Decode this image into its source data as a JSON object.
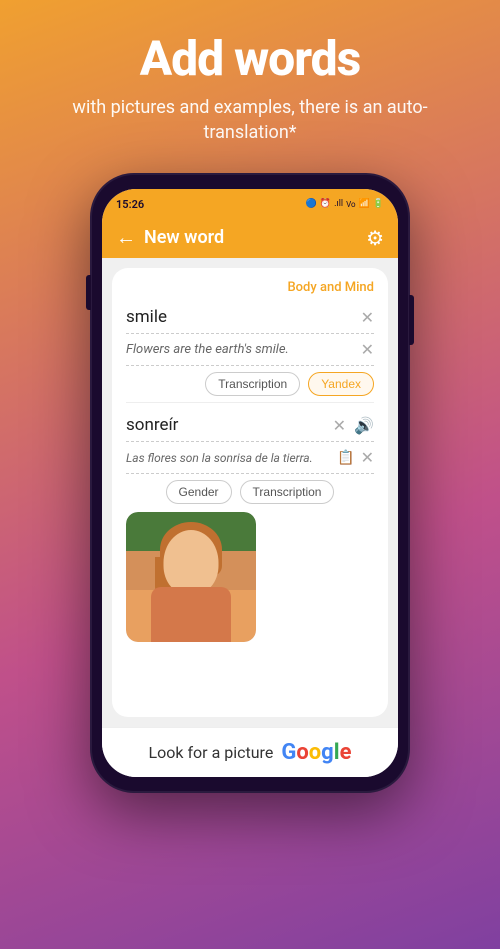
{
  "hero": {
    "title": "Add words",
    "subtitle": "with pictures and examples,\nthere is an auto-translation*"
  },
  "status_bar": {
    "time": "15:26",
    "icons": "🔵 ⏰ .ıll Vo WiFi 🔋"
  },
  "header": {
    "back_label": "←",
    "title": "New word",
    "gear_label": "⚙"
  },
  "card": {
    "category": "Body and Mind",
    "word": "smile",
    "example": "Flowers are the earth's smile.",
    "transcription_label": "Transcription",
    "yandex_label": "Yandex",
    "translation": "sonreír",
    "translation_example": "Las flores son la sonrisa de la tierra.",
    "gender_label": "Gender",
    "transcription2_label": "Transcription"
  },
  "google_bar": {
    "text": "Look for a picture",
    "google_letters": [
      "G",
      "o",
      "o",
      "g",
      "l",
      "e"
    ]
  }
}
